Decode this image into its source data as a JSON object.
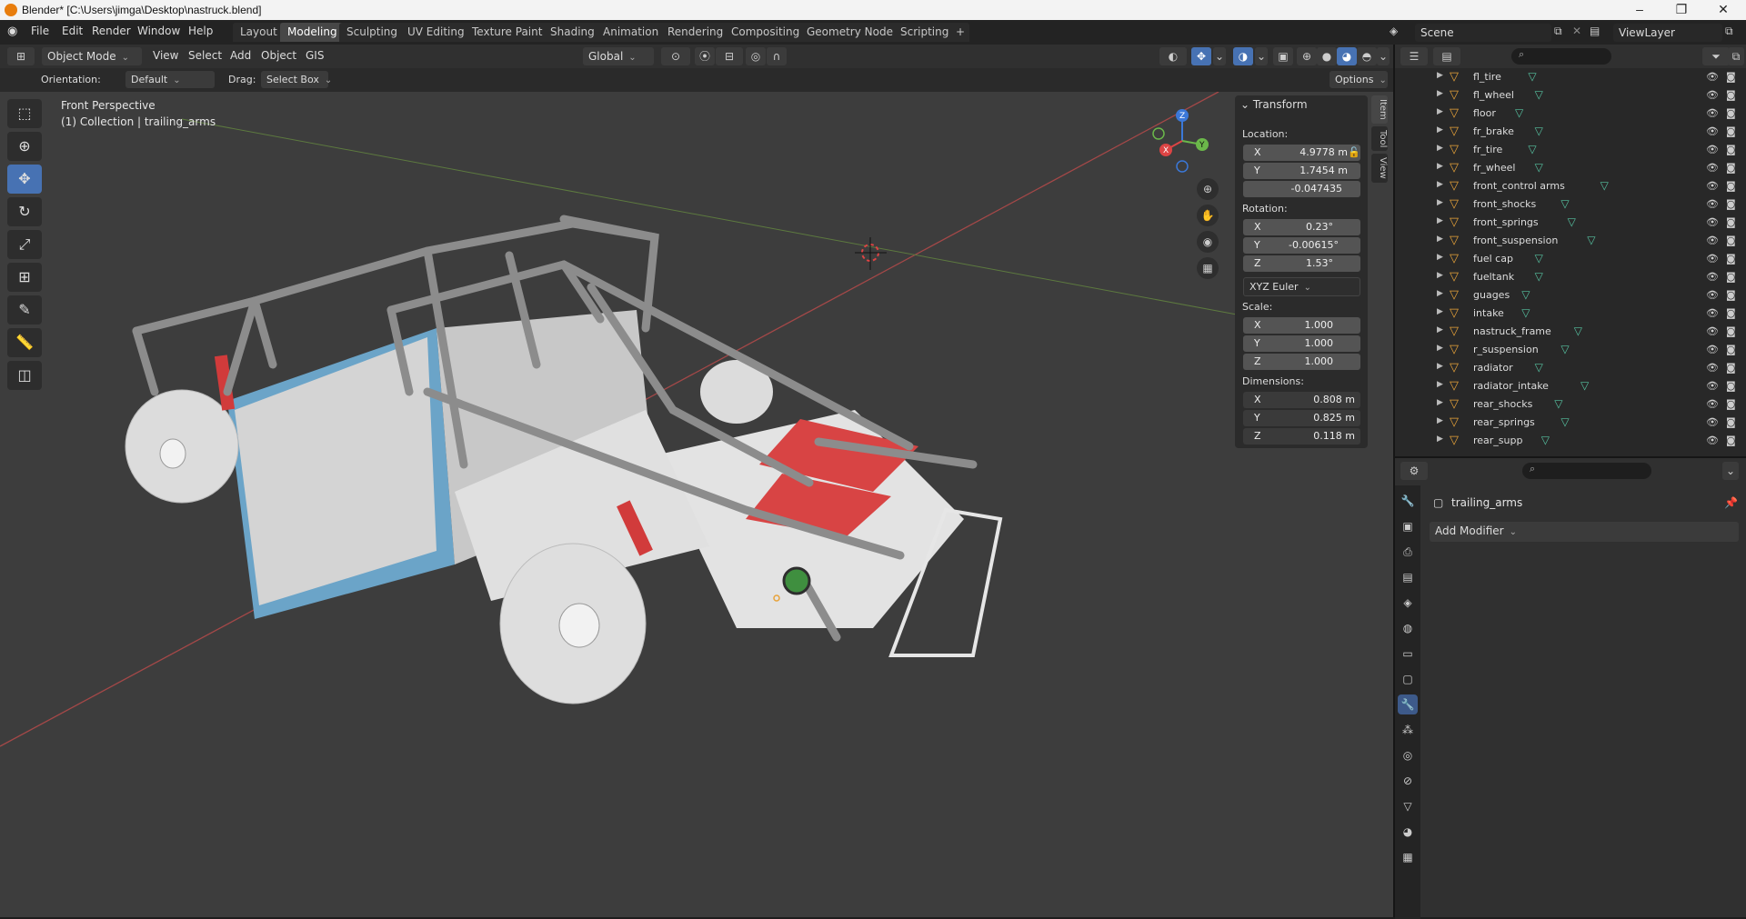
{
  "window": {
    "title": "Blender* [C:\\Users\\jimga\\Desktop\\nastruck.blend]"
  },
  "menus": [
    "File",
    "Edit",
    "Render",
    "Window",
    "Help"
  ],
  "workspaces": [
    {
      "label": "Layout",
      "active": false
    },
    {
      "label": "Modeling",
      "active": true
    },
    {
      "label": "Sculpting",
      "active": false
    },
    {
      "label": "UV Editing",
      "active": false
    },
    {
      "label": "Texture Paint",
      "active": false
    },
    {
      "label": "Shading",
      "active": false
    },
    {
      "label": "Animation",
      "active": false
    },
    {
      "label": "Rendering",
      "active": false
    },
    {
      "label": "Compositing",
      "active": false
    },
    {
      "label": "Geometry Nodes",
      "active": false
    },
    {
      "label": "Scripting",
      "active": false
    }
  ],
  "scene": {
    "name": "Scene",
    "view_layer": "ViewLayer"
  },
  "viewport_header": {
    "mode": "Object Mode",
    "menus": [
      "View",
      "Select",
      "Add",
      "Object",
      "GIS"
    ],
    "transform_orientation": "Global"
  },
  "tool_settings": {
    "orientation_label": "Orientation:",
    "orientation_value": "Default",
    "drag_label": "Drag:",
    "drag_value": "Select Box",
    "options": "Options"
  },
  "viewport": {
    "perspective": "Front Perspective",
    "collection": "(1) Collection | trailing_arms"
  },
  "transform": {
    "header": "Transform",
    "location_label": "Location:",
    "location": {
      "x": "4.9778 m",
      "y": "1.7454 m",
      "z": "-0.047435"
    },
    "rotation_label": "Rotation:",
    "rotation": {
      "x": "0.23°",
      "y": "-0.00615°",
      "z": "1.53°"
    },
    "rotation_mode": "XYZ Euler",
    "scale_label": "Scale:",
    "scale": {
      "x": "1.000",
      "y": "1.000",
      "z": "1.000"
    },
    "dimensions_label": "Dimensions:",
    "dimensions": {
      "x": "0.808 m",
      "y": "0.825 m",
      "z": "0.118 m"
    }
  },
  "side_tabs": [
    "Item",
    "Tool",
    "View"
  ],
  "outliner": [
    "fl_tire",
    "fl_wheel",
    "floor",
    "fr_brake",
    "fr_tire",
    "fr_wheel",
    "front_control arms",
    "front_shocks",
    "front_springs",
    "front_suspension",
    "fuel cap",
    "fueltank",
    "guages",
    "intake",
    "nastruck_frame",
    "r_suspension",
    "radiator",
    "radiator_intake",
    "rear_shocks",
    "rear_springs",
    "rear_supp"
  ],
  "properties": {
    "object_name": "trailing_arms",
    "add_modifier": "Add Modifier"
  },
  "colors": {
    "accent": "#4772b3",
    "object_icon": "#e8a33a",
    "mesh_icon": "#56c1a0",
    "viewport_bg": "#3d3d3d"
  }
}
